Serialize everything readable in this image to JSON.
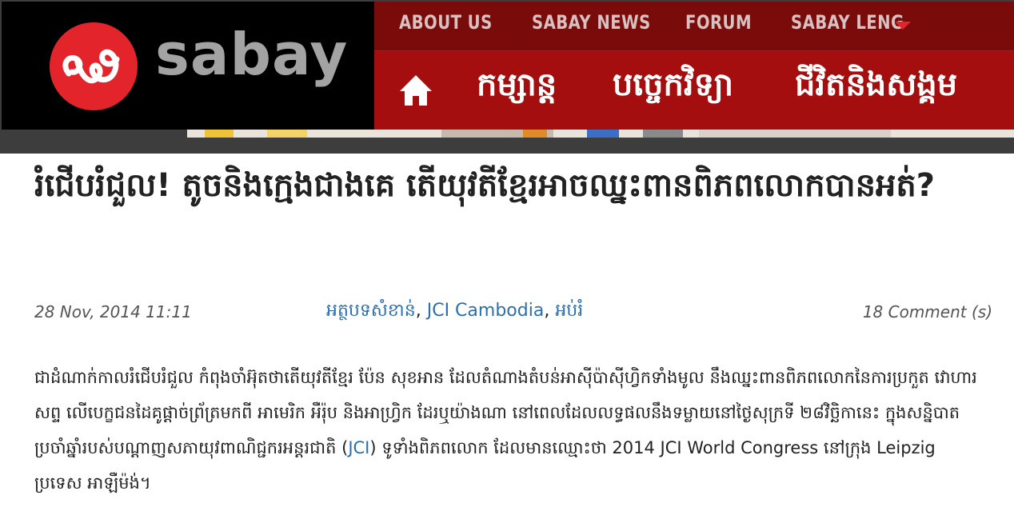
{
  "site": {
    "logo_text": "sabay",
    "logo_icon": "sabay-khmer-letter-logo",
    "colors": {
      "brand_red": "#e3242b",
      "nav_dark_red": "#7a0b0b",
      "nav_red": "#a50e0e",
      "link_blue": "#2b6fb0"
    }
  },
  "top_nav": {
    "items": [
      {
        "label": "ABOUT US"
      },
      {
        "label": "SABAY NEWS"
      },
      {
        "label": "FORUM"
      },
      {
        "label": "SABAY LENG"
      }
    ],
    "dropdown_icon": "caret-down-icon"
  },
  "main_nav": {
    "home_icon": "home-icon",
    "items": [
      {
        "label": "កម្សាន្ត"
      },
      {
        "label": "បច្ចេកវិទ្យា"
      },
      {
        "label": "ជីវិតនិងសង្គម"
      }
    ]
  },
  "article": {
    "title": "រំជើបរំជួល! តូចនិងក្មេងជាងគេ តើយុវតីខ្មែរអាចឈ្នះពានពិភពលោកបានអត់?",
    "date": "28 Nov, 2014 11:11",
    "categories": [
      {
        "label": "អត្ថបទសំខាន់"
      },
      {
        "label": "JCI Cambodia"
      },
      {
        "label": "អប់រំ"
      }
    ],
    "separator": ", ",
    "comments": "18  Comment (s)",
    "body": {
      "part1": "ជាដំណាក់កាលរំជើបរំជួល កំពុងចាំអ៊ុតថាតើយុវតីខ្មែរ ប៉ែន សុខអាន ដែលតំណាងតំបន់អាស៊ីប៉ាស៊ីហ្វិកទាំងមូល  នឹងឈ្នះពានពិភពលោកនៃការប្រកួត វោហារសព្ទ លើបេក្ខជនដៃគូផ្តាច់ព្រ័ត្រមកពី អាមេរិក អឺរ៉ុប និងអាហ្វ្រិក ដែរឬយ៉ាងណា នៅពេលដែលលទ្ធផលនឹងទម្លាយនៅថ្ងៃសុក្រទី ២៨វិច្ឆិកានេះ ក្នុងសន្និបាតប្រចាំឆ្នាំរបស់បណ្តាញសភាយុវពាណិជ្ជករអន្តរជាតិ (",
      "link": "JCI",
      "part2": ") ទូទាំងពិភពលោក ដែលមានឈ្មោះថា 2014 JCI World Congress  នៅក្រុង Leipzig ប្រទេស អាឡឺម៉ង់។"
    }
  }
}
